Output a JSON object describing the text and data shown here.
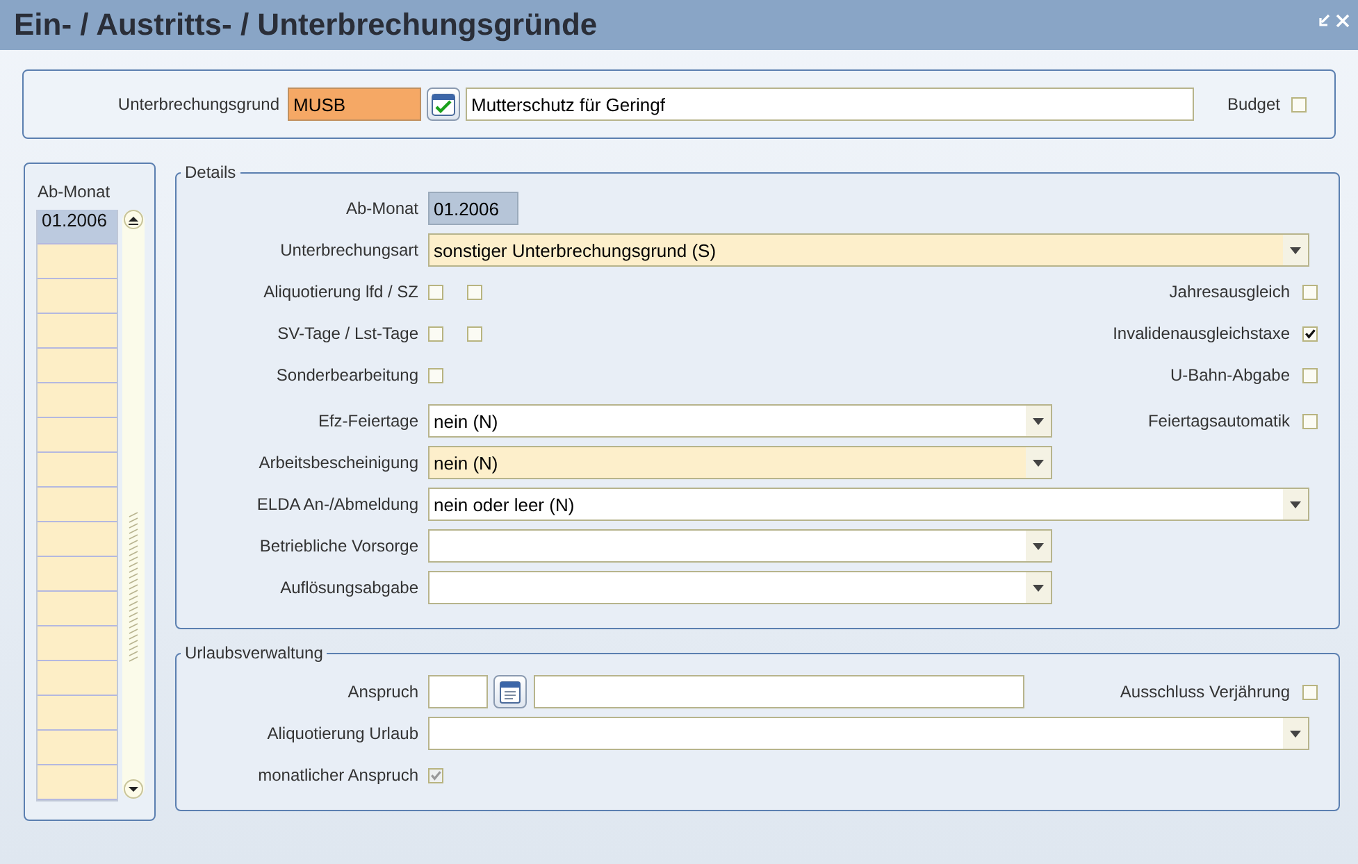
{
  "window": {
    "title": "Ein- / Austritts- / Unterbrechungsgründe"
  },
  "header": {
    "label": "Unterbrechungsgrund",
    "code": "MUSB",
    "description": "Mutterschutz für Geringf",
    "budget": {
      "label": "Budget",
      "checked": false
    }
  },
  "months": {
    "title": "Ab-Monat",
    "items": [
      {
        "label": "01.2006",
        "selected": true
      }
    ]
  },
  "details": {
    "title": "Details",
    "rows": [
      {
        "kind": "display",
        "label": "Ab-Monat",
        "value": "01.2006"
      },
      {
        "kind": "select",
        "label": "Unterbrechungsart",
        "value": "sonstiger Unterbrechungsgrund (S)",
        "required": true,
        "full": true
      },
      {
        "kind": "checks",
        "label": "Aliquotierung lfd / SZ",
        "checks": [
          {
            "checked": false,
            "disabled": false
          },
          {
            "checked": false,
            "disabled": false
          }
        ],
        "side": {
          "label": "Jahresausgleich",
          "checked": false
        }
      },
      {
        "kind": "checks",
        "label": "SV-Tage / Lst-Tage",
        "checks": [
          {
            "checked": false,
            "disabled": false
          },
          {
            "checked": false,
            "disabled": false
          }
        ],
        "side": {
          "label": "Invalidenausgleichstaxe",
          "checked": true
        }
      },
      {
        "kind": "checks",
        "label": "Sonderbearbeitung",
        "checks": [
          {
            "checked": false,
            "disabled": false
          }
        ],
        "side": {
          "label": "U-Bahn-Abgabe",
          "checked": false
        }
      },
      {
        "kind": "select",
        "label": "Efz-Feiertage",
        "value": "nein (N)",
        "required": false,
        "full": false,
        "side": {
          "label": "Feiertagsautomatik",
          "checked": false
        }
      },
      {
        "kind": "select",
        "label": "Arbeitsbescheinigung",
        "value": "nein (N)",
        "required": true,
        "full": false
      },
      {
        "kind": "select",
        "label": "ELDA An-/Abmeldung",
        "value": "nein oder leer (N)",
        "required": false,
        "full": true
      },
      {
        "kind": "select",
        "label": "Betriebliche Vorsorge",
        "required": false,
        "full": false
      },
      {
        "kind": "select",
        "label": "Auflösungsabgabe",
        "required": false,
        "full": false
      }
    ]
  },
  "vacation": {
    "title": "Urlaubsverwaltung",
    "rows": [
      {
        "kind": "entry",
        "label": "Anspruch",
        "side": {
          "label": "Ausschluss Verjährung",
          "checked": false
        }
      },
      {
        "kind": "select",
        "label": "Aliquotierung Urlaub",
        "required": false,
        "full": true
      },
      {
        "kind": "checks",
        "label": "monatlicher Anspruch",
        "checks": [
          {
            "checked": true,
            "disabled": true
          }
        ]
      }
    ]
  }
}
